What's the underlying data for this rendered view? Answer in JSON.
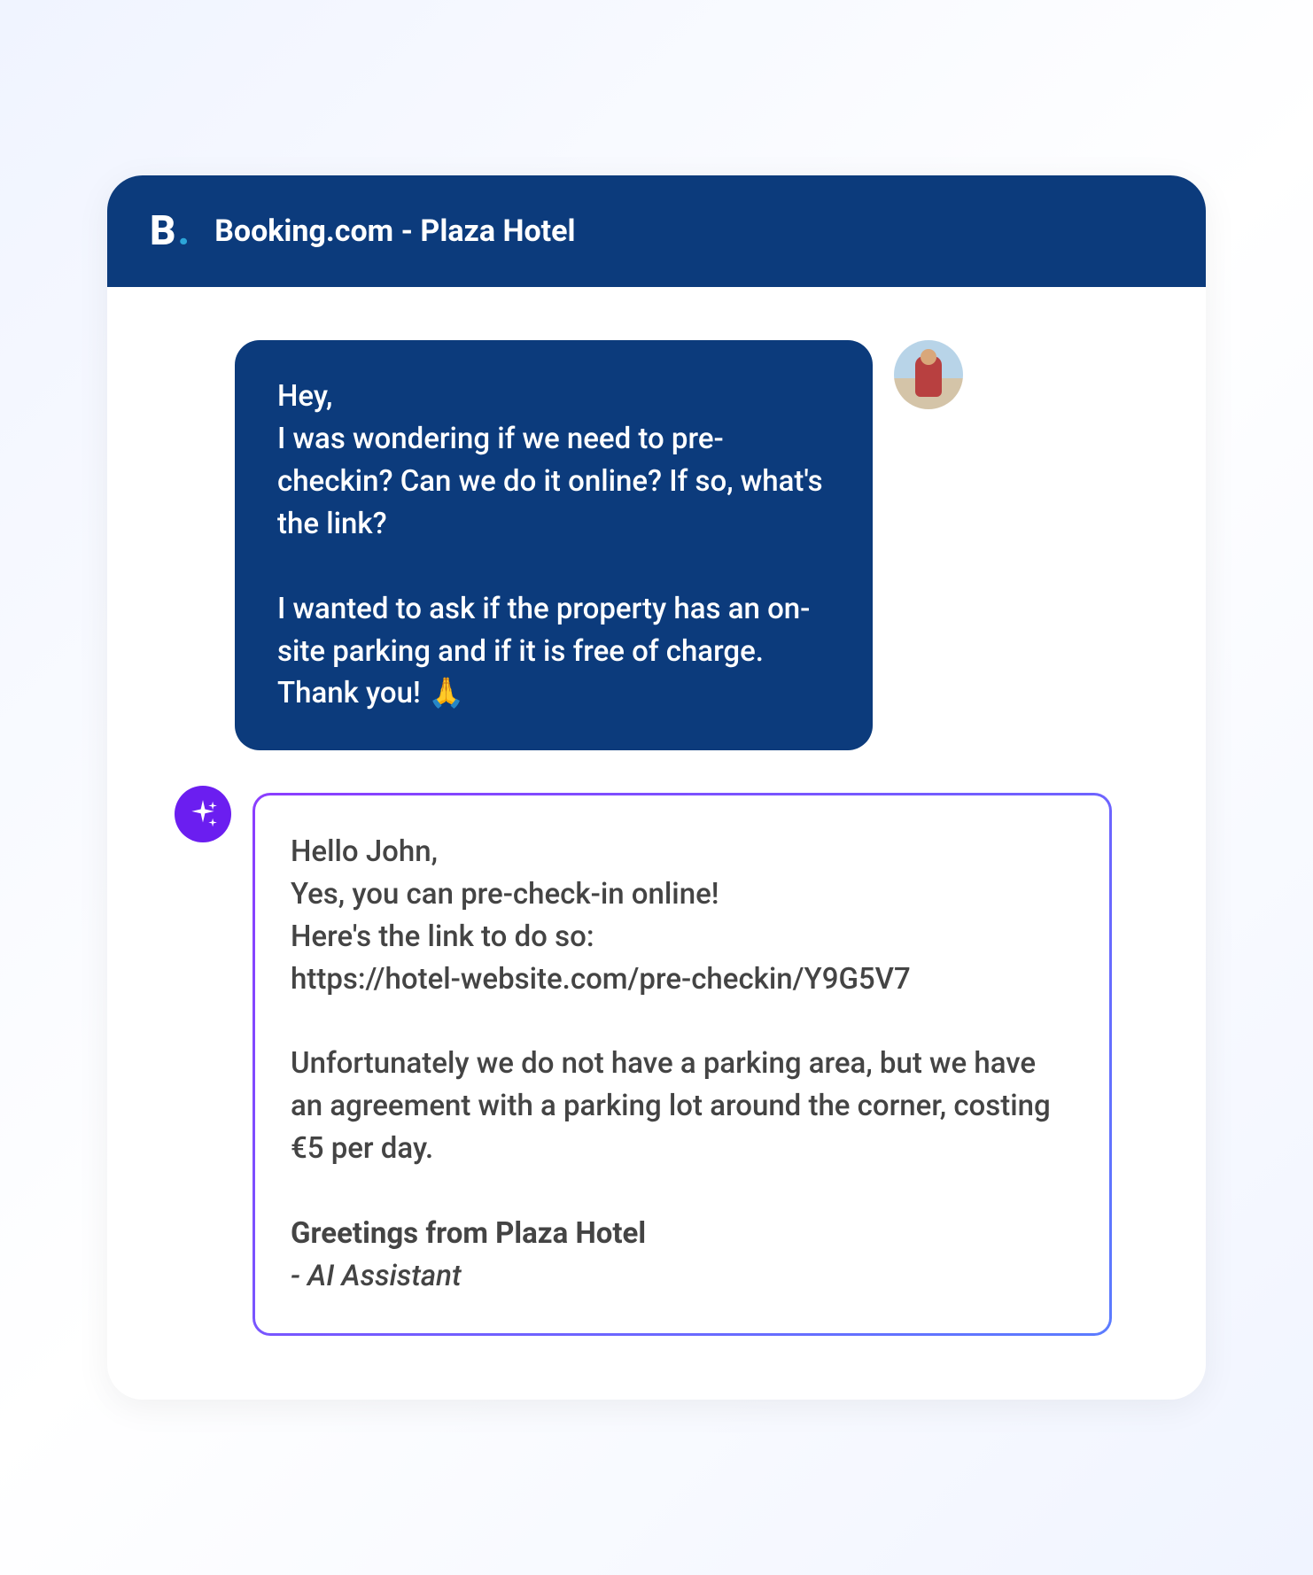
{
  "header": {
    "logo_letter": "B",
    "logo_dot": ".",
    "title": "Booking.com - Plaza Hotel"
  },
  "messages": {
    "user": {
      "text": "Hey,\nI was wondering if we need to pre-checkin? Can we do it online? If so, what's the link?\n\nI wanted to ask if the property has an on-site parking and if it is free of charge.\nThank you! 🙏"
    },
    "ai": {
      "greeting": "Hello John,",
      "body1": "Yes, you can pre-check-in online!\nHere's the link to do so:\nhttps://hotel-website.com/pre-checkin/Y9G5V7",
      "body2": "Unfortunately we do not have a parking area, but we have an agreement with a parking lot around the corner, costing €5 per day.",
      "closing": "Greetings from Plaza Hotel",
      "signature": "- AI Assistant"
    }
  }
}
